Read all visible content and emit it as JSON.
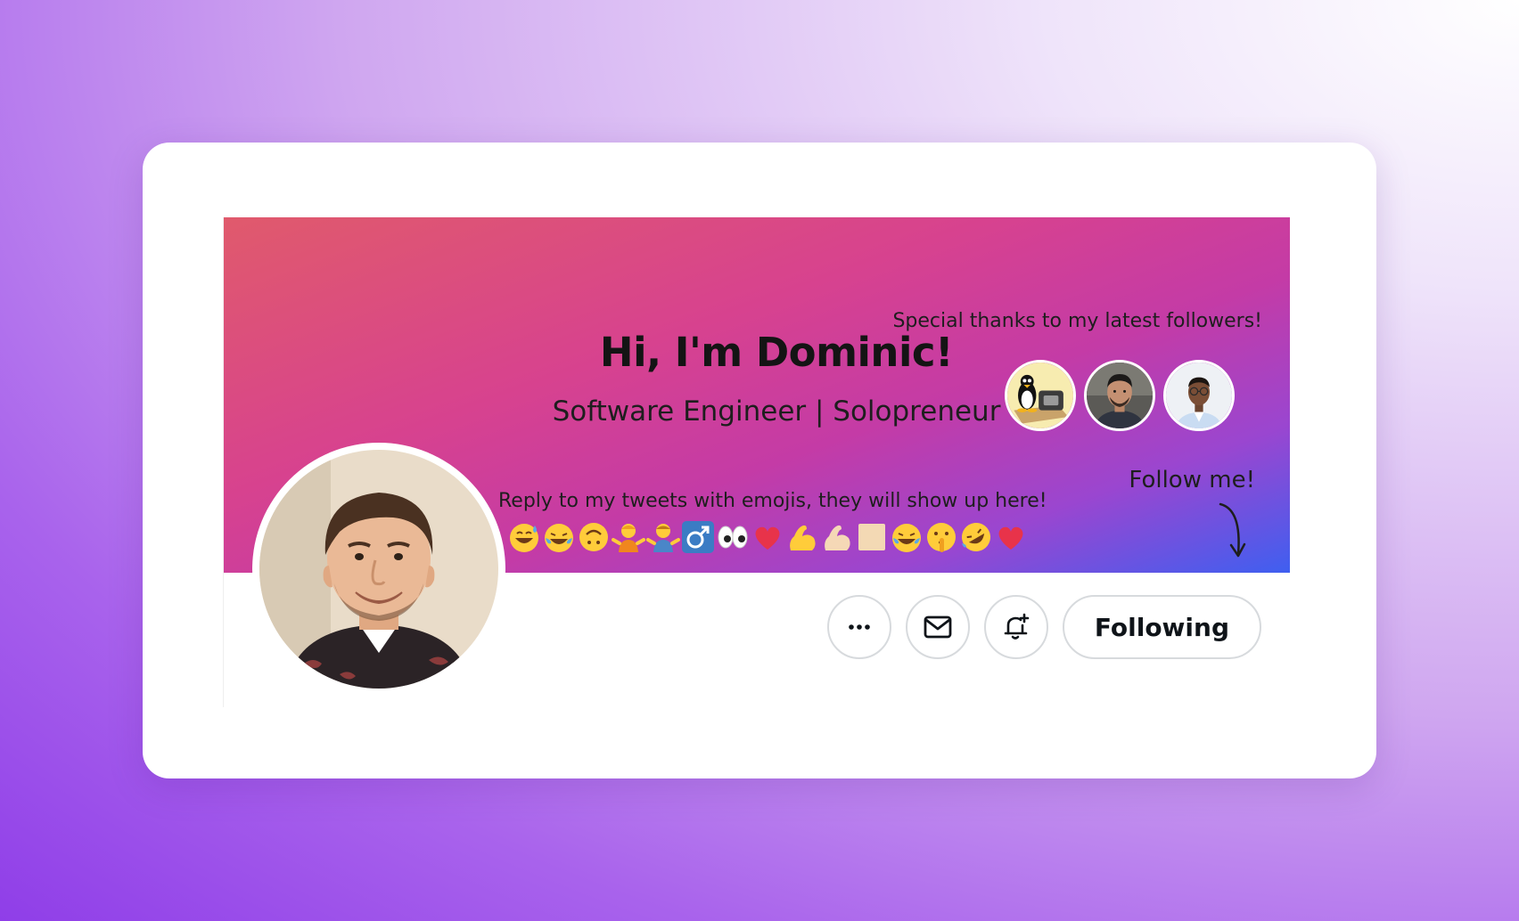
{
  "banner": {
    "title": "Hi, I'm Dominic!",
    "subtitle": "Software Engineer | Solopreneur",
    "thanks_text": "Special thanks to my latest followers!",
    "follow_me_text": "Follow me!",
    "emoji_caption": "Reply to my tweets with emojis, they will show up here!",
    "followers": [
      {
        "name": "follower-avatar-penguin",
        "icon": "linux-penguin-avatar"
      },
      {
        "name": "follower-avatar-man",
        "icon": "man-photo-avatar"
      },
      {
        "name": "follower-avatar-person",
        "icon": "person-with-glasses-avatar"
      }
    ],
    "emojis": [
      "😅",
      "😂",
      "🙃",
      "🤷",
      "🤷",
      "♂",
      "👀",
      "❤️",
      "💪",
      "💪🏻",
      "⬜",
      "😂",
      "🤫",
      "🤣",
      "❤️"
    ]
  },
  "actions": {
    "more_icon": "more-horizontal-icon",
    "message_icon": "envelope-icon",
    "notify_icon": "bell-plus-icon",
    "following_label": "Following"
  },
  "colors": {
    "banner_start": "#e05a6c",
    "banner_mid": "#c43ba6",
    "banner_end": "#3f5ff0",
    "button_border": "#d7dadd",
    "text_dark": "#0f1419"
  }
}
